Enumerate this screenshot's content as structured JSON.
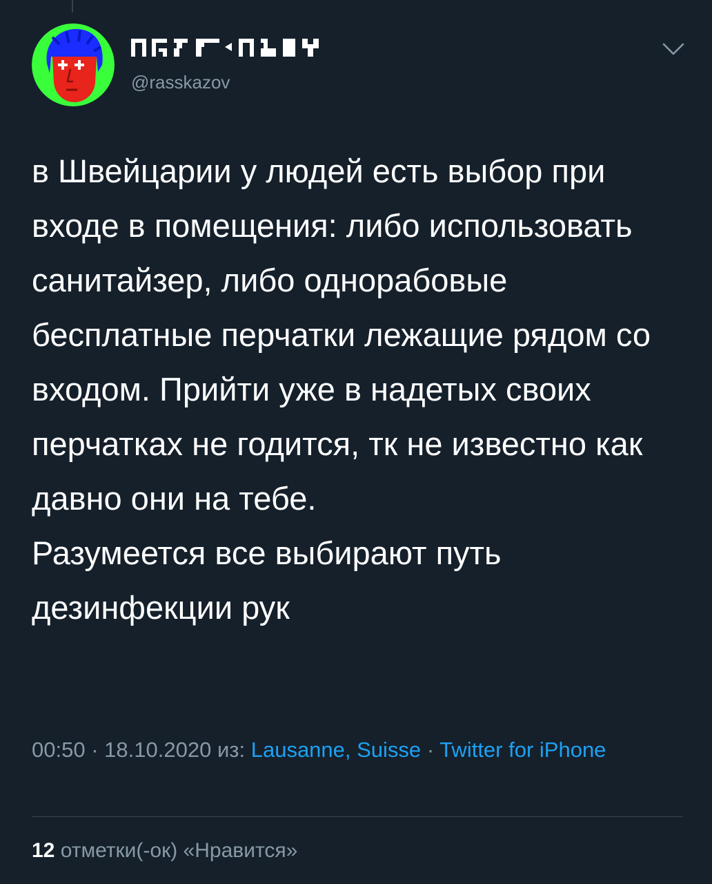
{
  "tweet": {
    "author": {
      "display_name": "▛▖▞▘▞▀▗▖▝▜▌▌▘",
      "handle": "@rasskazov",
      "avatar_icon": "avatar-image"
    },
    "menu_icon": "chevron-down-icon",
    "text": "в Швейцарии у людей есть выбор при входе в помещения: либо использовать санитайзер, либо однорабовые бесплатные перчатки лежащие рядом со входом. Прийти уже в надетых своих перчатках не годится, тк не известно как давно они на тебе.\nРазумеется все выбирают путь дезинфекции рук",
    "time": "00:50",
    "separator": "·",
    "date": "18.10.2020",
    "from_label": "из:",
    "location": "Lausanne, Suisse",
    "source": "Twitter for iPhone",
    "likes_count": "12",
    "likes_label": "отметки(-ок) «Нравится»"
  },
  "colors": {
    "background": "#15202b",
    "text": "#ffffff",
    "secondary": "#8899a6",
    "link": "#1da1f2",
    "divider": "#38444d"
  }
}
